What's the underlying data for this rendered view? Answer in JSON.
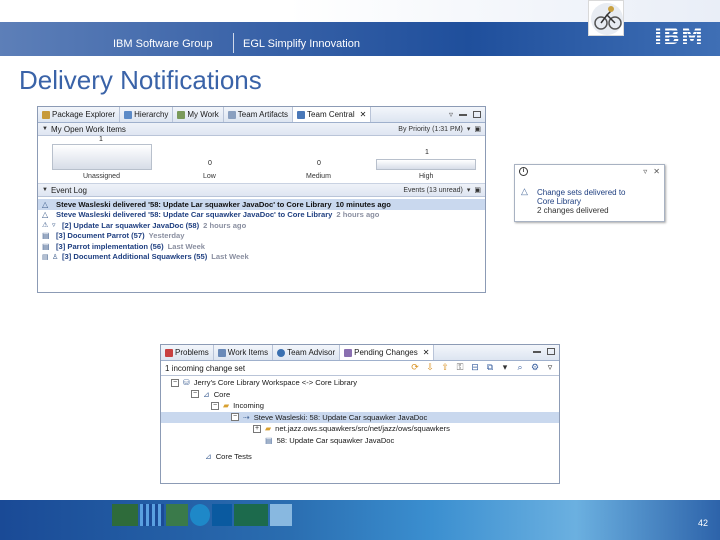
{
  "header": {
    "group": "IBM Software Group",
    "tagline": "EGL Simplify Innovation",
    "logo": "IBM"
  },
  "title": "Delivery Notifications",
  "eclipse_top": {
    "tabs": [
      {
        "label": "Package Explorer",
        "icon": "package-icon"
      },
      {
        "label": "Hierarchy",
        "icon": "hierarchy-icon"
      },
      {
        "label": "My Work",
        "icon": "my-work-icon"
      },
      {
        "label": "Team Artifacts",
        "icon": "team-artifacts-icon"
      },
      {
        "label": "Team Central",
        "icon": "team-central-icon",
        "active": true
      }
    ],
    "my_open_work_items": {
      "label": "My Open Work Items",
      "grouping": "By Priority (1:31 PM)",
      "bars": [
        {
          "category": "Unassigned",
          "value": 1
        },
        {
          "category": "Low",
          "value": 0
        },
        {
          "category": "Medium",
          "value": 0
        },
        {
          "category": "High",
          "value": 1
        }
      ]
    },
    "event_log": {
      "label": "Event Log",
      "filter": "Events (13 unread)",
      "entries": [
        {
          "icon": "delivery-icon",
          "text": "Steve Wasleski delivered '58: Update Lar squawker JavaDoc' to Core Library",
          "ago": "10 minutes ago",
          "selected": true
        },
        {
          "icon": "delivery-icon",
          "text": "Steve Wasleski delivered '58: Update Car squawker JavaDoc' to Core Library",
          "ago": "2 hours ago"
        },
        {
          "icon": "work-item-icon",
          "text": "[2] Update Lar squawker JavaDoc (58)",
          "ago": "2 hours ago"
        },
        {
          "icon": "document-icon",
          "text": "[3] Document Parrot (57)",
          "ago": "Yesterday"
        },
        {
          "icon": "document-icon",
          "text": "[3] Parrot implementation (56)",
          "ago": "Last Week"
        },
        {
          "icon": "document-icon",
          "text": "[3] Document Additional Squawkers (55)",
          "ago": "Last Week"
        }
      ]
    }
  },
  "popup": {
    "line1": "Change sets delivered to",
    "line2": "Core Library",
    "line3": "2 changes delivered"
  },
  "eclipse_bottom": {
    "tabs": [
      {
        "label": "Problems",
        "icon": "problems-icon"
      },
      {
        "label": "Work Items",
        "icon": "work-items-icon"
      },
      {
        "label": "Team Advisor",
        "icon": "team-advisor-icon"
      },
      {
        "label": "Pending Changes",
        "icon": "pending-changes-icon",
        "active": true
      }
    ],
    "status": "1 incoming change set",
    "tree": [
      {
        "level": 0,
        "expander": "−",
        "icon": "workspace-icon",
        "label": "Jerry's Core Library Workspace <-> Core Library"
      },
      {
        "level": 1,
        "expander": "−",
        "icon": "component-icon",
        "label": "Core"
      },
      {
        "level": 2,
        "expander": "−",
        "icon": "folder-icon",
        "label": "Incoming"
      },
      {
        "level": 3,
        "expander": "−",
        "icon": "change-set-icon",
        "label": "Steve Wasleski: 58: Update Car squawker JavaDoc",
        "selected": true
      },
      {
        "level": 4,
        "expander": "+",
        "icon": "package-folder-icon",
        "label": "net.jazz.ows.squawkers/src/net/jazz/ows/squawkers"
      },
      {
        "level": 4,
        "expander": "",
        "icon": "work-item-icon",
        "label": "58: Update Car squawker JavaDoc"
      },
      {
        "level": 1,
        "expander": "",
        "icon": "component-icon",
        "label": "Core Tests"
      }
    ]
  },
  "footer": {
    "page_number": "42"
  }
}
